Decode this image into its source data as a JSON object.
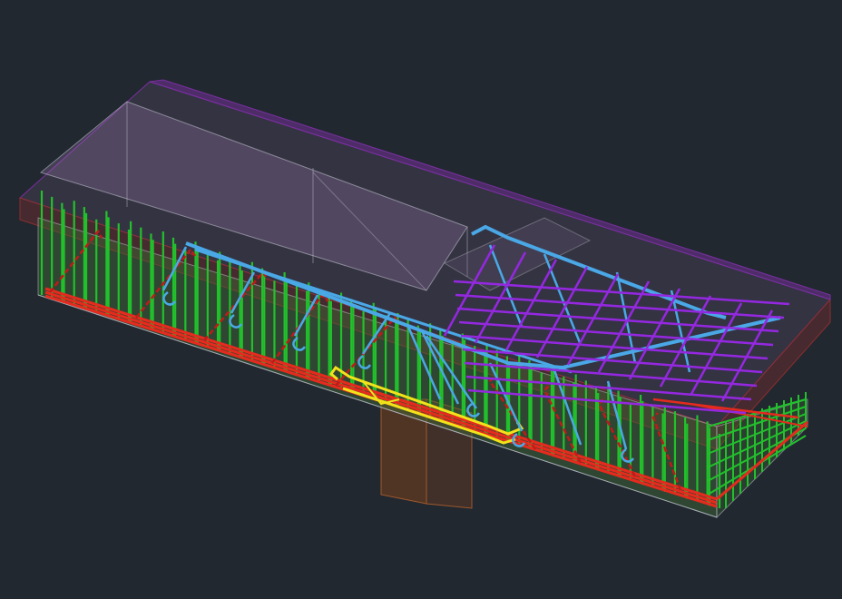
{
  "viewport": {
    "background": "#212830"
  },
  "layer_colors": {
    "concrete_outline": "#b9bcc6",
    "concrete_fill_top": "#8a6a93",
    "concrete_fill_side": "#3e6a35",
    "slab_edge_red": "#8b2f2f",
    "slab_edge_violet": "#7a2fa0",
    "column": "#7a3f1c",
    "stirrups_green": "#22c12c",
    "bottom_bars_red": "#e52a1e",
    "bent_bars_blue": "#4aa8e6",
    "top_mesh_purple": "#9428e0",
    "support_bars_yellow": "#f2e21a",
    "bent_bars_dark_red": "#c11a1a"
  },
  "icons": {
    "model": "rebar-3d-model-icon"
  }
}
